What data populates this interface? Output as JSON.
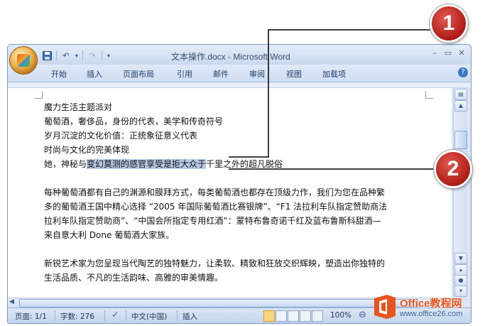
{
  "window": {
    "title": "文本操作.docx - Microsoft Word",
    "controls": {
      "minimize": "–",
      "restore": "▭",
      "close": "✕"
    }
  },
  "quick_access": {
    "save_icon": "save-icon",
    "undo_glyph": "↶",
    "redo_glyph": "↷",
    "dropdown_glyph": "▾"
  },
  "ribbon": {
    "tabs": [
      "开始",
      "插入",
      "页面布局",
      "引用",
      "邮件",
      "审阅",
      "视图",
      "加载项"
    ],
    "help_glyph": "?"
  },
  "document": {
    "lines": [
      "魔力生活主题派对",
      "葡萄酒，奢侈品，身份的代表，美学和传奇符号",
      "岁月沉淀的文化价值：正统象征意义代表",
      "时尚与文化的完美体现"
    ],
    "selection_line": {
      "before": "她，神秘与",
      "selected": "变幻莫测的感官享受是拒大众于",
      "after": "千里之外的超凡脱俗"
    },
    "paragraph1": [
      "每种葡萄酒都有自己的渊源和膜拜方式，每类葡萄酒也都存在顶级力作，我们为您在品种繁",
      "多的葡萄酒王国中精心选择 “2005 年国际葡萄酒比赛银牌”、“F1 法拉利车队指定赞助商法",
      "拉利车队指定赞助商”、“中国会所指定专用红酒”：蒙特布鲁奇诺千红及蓝布鲁斯科甜酒—",
      "来自意大利 Done 葡萄酒大家族。"
    ],
    "paragraph2": [
      "新锐艺术家为您呈现当代陶艺的独特魅力，让柔软、精致和狂放交织辉映，塑造出你独特的",
      "生活品质、不凡的生活韵味、高雅的审美情趣。"
    ]
  },
  "statusbar": {
    "page": "页面: 1/1",
    "words": "字数: 276",
    "language": "中文(中国)",
    "insert": "插入",
    "zoom": "100%"
  },
  "callouts": [
    "1",
    "2"
  ],
  "watermark": {
    "brand": "Office教程网",
    "url": "www.office26.com"
  }
}
